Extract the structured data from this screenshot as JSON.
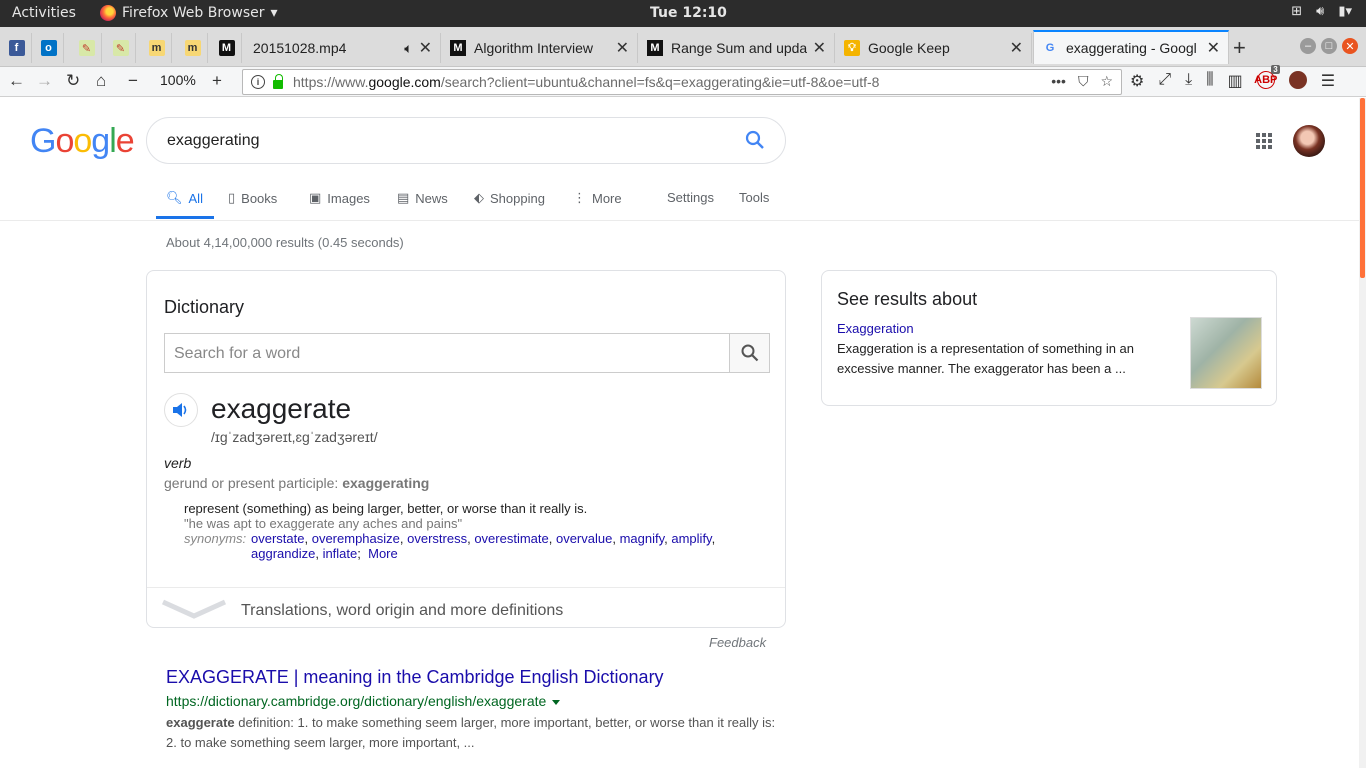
{
  "os": {
    "activities": "Activities",
    "app_name": "Firefox Web Browser",
    "clock": "Tue 12:10"
  },
  "tabs": [
    {
      "title": "20151028.mp4",
      "favicon": "video-file-icon",
      "audio": true
    },
    {
      "title": "Algorithm Interview",
      "favicon": "medium-icon"
    },
    {
      "title": "Range Sum and upda",
      "favicon": "medium-icon"
    },
    {
      "title": "Google Keep",
      "favicon": "keep-icon"
    },
    {
      "title": "exaggerating - Googl",
      "favicon": "google-icon",
      "active": true
    }
  ],
  "nav": {
    "zoom": "100%",
    "url_prefix": "https://www.",
    "url_domain": "google.com",
    "url_rest": "/search?client=ubuntu&channel=fs&q=exaggerating&ie=utf-8&oe=utf-8",
    "abp_count": "3"
  },
  "google": {
    "query": "exaggerating",
    "tabs": [
      "All",
      "Books",
      "Images",
      "News",
      "Shopping",
      "More"
    ],
    "settings": "Settings",
    "tools": "Tools",
    "stats": "About 4,14,00,000 results (0.45 seconds)"
  },
  "dictionary": {
    "heading": "Dictionary",
    "search_placeholder": "Search for a word",
    "word": "exaggerate",
    "phonetic": "/ɪɡˈzadʒəreɪt,ɛɡˈzadʒəreɪt/",
    "part_of_speech": "verb",
    "gerund_prefix": "gerund or present participle: ",
    "gerund": "exaggerating",
    "definition": "represent (something) as being larger, better, or worse than it really is.",
    "example": "\"he was apt to exaggerate any aches and pains\"",
    "synonyms_label": "synonyms:",
    "synonyms": [
      "overstate",
      "overemphasize",
      "overstress",
      "overestimate",
      "overvalue",
      "magnify",
      "amplify",
      "aggrandize",
      "inflate"
    ],
    "more": "More",
    "footer": "Translations, word origin and more definitions",
    "feedback": "Feedback"
  },
  "result": {
    "title": "EXAGGERATE | meaning in the Cambridge English Dictionary",
    "url": "https://dictionary.cambridge.org/dictionary/english/exaggerate",
    "snippet_bold": "exaggerate",
    "snippet": " definition: 1. to make something seem larger, more important, better, or worse than it really is: 2. to make something seem larger, more important, ..."
  },
  "knowledge_panel": {
    "heading": "See results about",
    "link": "Exaggeration",
    "description": "Exaggeration is a representation of something in an excessive manner. The exaggerator has been a ..."
  },
  "colors": {
    "google_blue": "#4285f4",
    "google_red": "#ea4335",
    "google_yellow": "#fbbc05",
    "google_green": "#34a853",
    "link": "#1a0dab",
    "url_green": "#006621",
    "tab_accent": "#0a84ff"
  }
}
